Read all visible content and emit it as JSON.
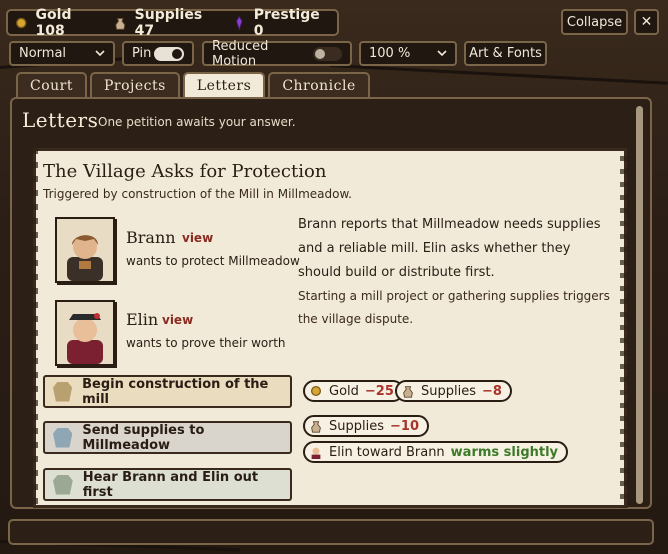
{
  "resources": {
    "gold": "Gold 108",
    "supplies": "Supplies 47",
    "prestige": "Prestige 0"
  },
  "window": {
    "collapse_label": "Collapse",
    "close_label": "✕"
  },
  "toolbar": {
    "difficulty_value": "Normal",
    "pin_label": "Pin",
    "pin_on": true,
    "reduced_motion_label": "Reduced Motion",
    "reduced_motion_on": false,
    "zoom_value": "100 %",
    "art_fonts_label": "Art & Fonts"
  },
  "tabs": [
    {
      "label": "Court",
      "active": false
    },
    {
      "label": "Projects",
      "active": false
    },
    {
      "label": "Letters",
      "active": true
    },
    {
      "label": "Chronicle",
      "active": false
    }
  ],
  "letters": {
    "heading": "Letters",
    "subtitle": "One petition awaits your answer."
  },
  "petition": {
    "title": "The Village Asks for Protection",
    "trigger": "Triggered by construction of the Mill in Millmeadow.",
    "characters": [
      {
        "name": "Brann",
        "view_label": "view",
        "desire": "wants to protect Millmeadow"
      },
      {
        "name": "Elin",
        "view_label": "view",
        "desire": "wants to prove their worth"
      }
    ],
    "body_1": "Brann reports that Millmeadow needs supplies and a reliable mill. Elin asks whether they should build or distribute first.",
    "body_2": "Starting a mill project or gathering supplies triggers the village dispute.",
    "choices": [
      {
        "label": "Begin construction of the mill",
        "effects": [
          {
            "label": "Gold",
            "value": "−25",
            "kind": "negative"
          },
          {
            "label": "Supplies",
            "value": "−8",
            "kind": "negative"
          }
        ]
      },
      {
        "label": "Send supplies to Millmeadow",
        "effects": [
          {
            "label": "Supplies",
            "value": "−10",
            "kind": "negative"
          },
          {
            "label": "Elin toward Brann",
            "value": "warms slightly",
            "kind": "positive"
          }
        ]
      },
      {
        "label": "Hear Brann and Elin out first",
        "effects": []
      }
    ]
  },
  "colors": {
    "bg_dark": "#2a1d14",
    "border": "#7a6548",
    "parchment": "#f1ead9",
    "negative": "#a8342a",
    "positive": "#3d7a2a",
    "accent_name": "#8a2a20"
  }
}
